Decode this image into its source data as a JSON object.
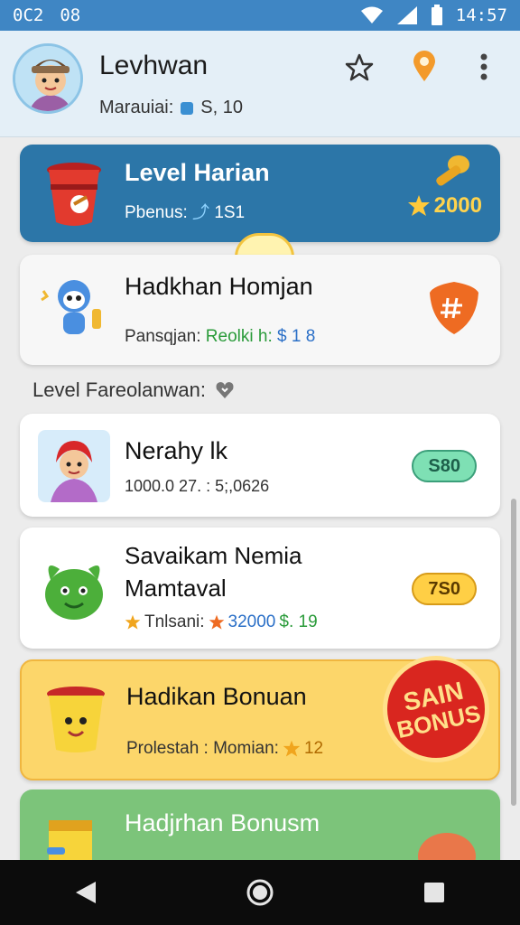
{
  "status_bar": {
    "left_1": "0C2",
    "left_2": "08",
    "time": "14:57"
  },
  "header": {
    "name": "Levhwan",
    "sub_label": "Marauiai:",
    "sub_value": "S, 10"
  },
  "cards": {
    "level_harian": {
      "title": "Level Harian",
      "sub_label": "Pbenus:",
      "sub_value": "1S1",
      "score": "2000"
    },
    "hadkhan": {
      "title": "Hadkhan Homjan",
      "sub_label": "Pansqjan:",
      "sub_mid": "Reolki h:",
      "sub_value": "$ 1 8"
    },
    "nerahy": {
      "title": "Nerahy lk",
      "sub": "1000.0 27. : 5;,0626",
      "pill": "S80"
    },
    "savaikam": {
      "title_1": "Savaikam Nemia",
      "title_2": "Mamtaval",
      "sub_label": "Tnlsani:",
      "sub_value_1": "32000",
      "sub_value_2": "$. 19",
      "pill": "7S0"
    },
    "hadikan_bonuan": {
      "title": "Hadikan Bonuan",
      "sub_label": "Prolestah : Momian:",
      "sub_value": "12",
      "badge_line1": "SAIN",
      "badge_line2": "BONUS"
    },
    "hadjrhan": {
      "title": "Hadjrhan Bonusm"
    }
  },
  "section": {
    "label": "Level Fareolanwan:"
  },
  "icons": [
    "wifi-icon",
    "signal-icon",
    "battery-icon",
    "star-outline-icon",
    "location-pin-icon",
    "more-vert-icon",
    "back-icon",
    "home-icon",
    "recents-icon"
  ],
  "colors": {
    "status_bar": "#3f86c4",
    "blue_card": "#2c76a8",
    "yellow_card": "#fcd66a",
    "green_card": "#7cc47a"
  }
}
